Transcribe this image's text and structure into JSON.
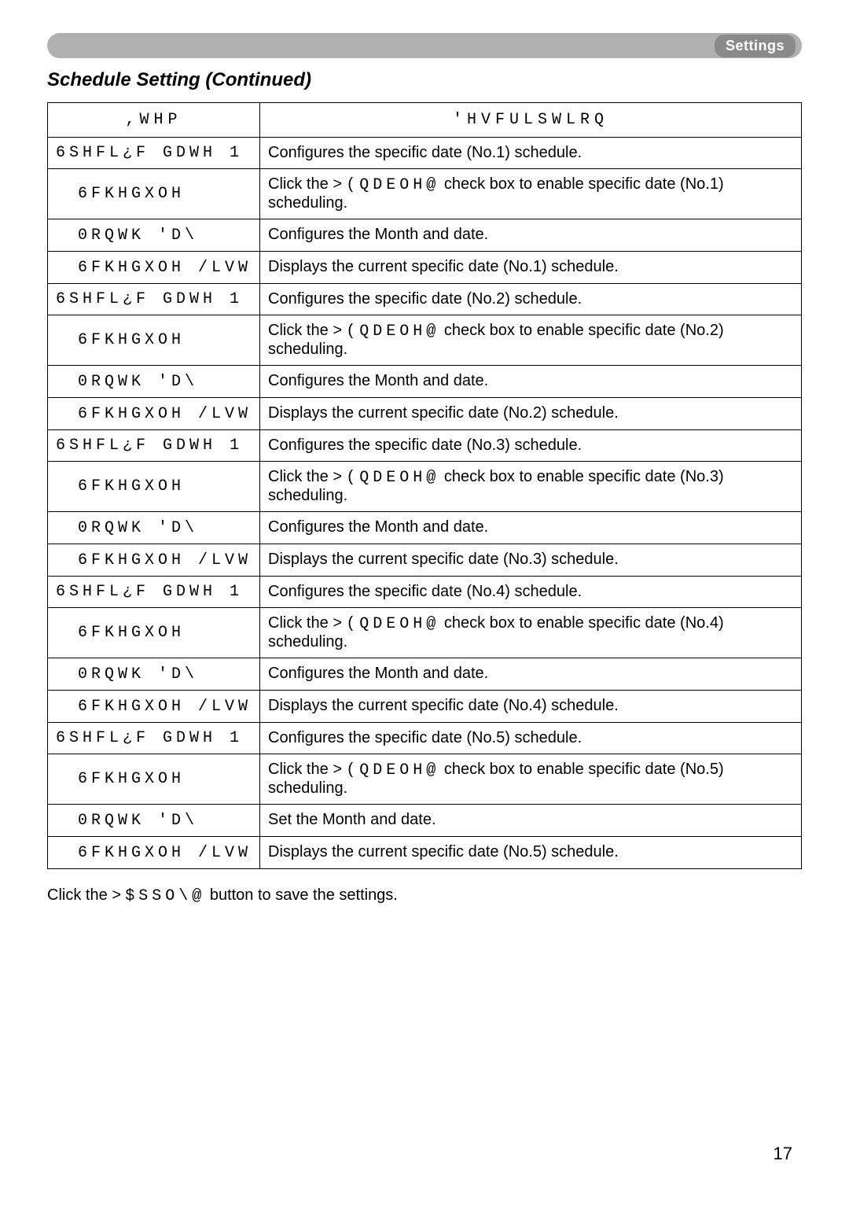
{
  "header": {
    "settings_label": "Settings"
  },
  "title": "Schedule Setting (Continued)",
  "table": {
    "head_item": ",WHP",
    "head_desc": "'HVFULSWLRQ",
    "groups": [
      {
        "parent_item": "6SHFL¿F GDWH 1",
        "parent_desc": "Configures the specific date (No.1) schedule.",
        "children": [
          {
            "item": "6FKHGXOH",
            "desc_pre": "Click the ",
            "desc_mono": ">(QDEOH@",
            "desc_post": " check box to enable specific date (No.1) scheduling."
          },
          {
            "item": "0RQWK 'D\\",
            "desc_pre": "Configures the Month and date.",
            "desc_mono": "",
            "desc_post": ""
          },
          {
            "item": "6FKHGXOH /LVW",
            "desc_pre": "Displays the current specific date (No.1) schedule.",
            "desc_mono": "",
            "desc_post": ""
          }
        ]
      },
      {
        "parent_item": "6SHFL¿F GDWH 1",
        "parent_desc": "Configures the specific date (No.2) schedule.",
        "children": [
          {
            "item": "6FKHGXOH",
            "desc_pre": "Click the ",
            "desc_mono": ">(QDEOH@",
            "desc_post": " check box to enable specific date (No.2) scheduling."
          },
          {
            "item": "0RQWK 'D\\",
            "desc_pre": "Configures the Month and date.",
            "desc_mono": "",
            "desc_post": ""
          },
          {
            "item": "6FKHGXOH /LVW",
            "desc_pre": "Displays the current specific date (No.2) schedule.",
            "desc_mono": "",
            "desc_post": ""
          }
        ]
      },
      {
        "parent_item": "6SHFL¿F GDWH 1",
        "parent_desc": "Configures the specific date (No.3) schedule.",
        "children": [
          {
            "item": "6FKHGXOH",
            "desc_pre": "Click the ",
            "desc_mono": ">(QDEOH@",
            "desc_post": " check box to enable specific date (No.3) scheduling."
          },
          {
            "item": "0RQWK 'D\\",
            "desc_pre": "Configures the Month and date.",
            "desc_mono": "",
            "desc_post": ""
          },
          {
            "item": "6FKHGXOH /LVW",
            "desc_pre": "Displays the current specific date (No.3) schedule.",
            "desc_mono": "",
            "desc_post": ""
          }
        ]
      },
      {
        "parent_item": "6SHFL¿F GDWH 1",
        "parent_desc": "Configures the specific date (No.4) schedule.",
        "children": [
          {
            "item": "6FKHGXOH",
            "desc_pre": "Click the ",
            "desc_mono": ">(QDEOH@",
            "desc_post": " check box to enable specific date (No.4) scheduling."
          },
          {
            "item": "0RQWK 'D\\",
            "desc_pre": "Configures the Month and date.",
            "desc_mono": "",
            "desc_post": ""
          },
          {
            "item": "6FKHGXOH /LVW",
            "desc_pre": "Displays the current specific date (No.4) schedule.",
            "desc_mono": "",
            "desc_post": ""
          }
        ]
      },
      {
        "parent_item": "6SHFL¿F GDWH 1",
        "parent_desc": "Configures the specific date (No.5) schedule.",
        "children": [
          {
            "item": "6FKHGXOH",
            "desc_pre": "Click the ",
            "desc_mono": ">(QDEOH@",
            "desc_post": " check box to enable specific date (No.5) scheduling."
          },
          {
            "item": "0RQWK 'D\\",
            "desc_pre": "Set the Month and date.",
            "desc_mono": "",
            "desc_post": ""
          },
          {
            "item": "6FKHGXOH /LVW",
            "desc_pre": "Displays the current specific date (No.5) schedule.",
            "desc_mono": "",
            "desc_post": ""
          }
        ]
      }
    ]
  },
  "note_pre": "Click the ",
  "note_mono": ">$SSO\\@",
  "note_post": " button to save the settings.",
  "page_number": "17"
}
